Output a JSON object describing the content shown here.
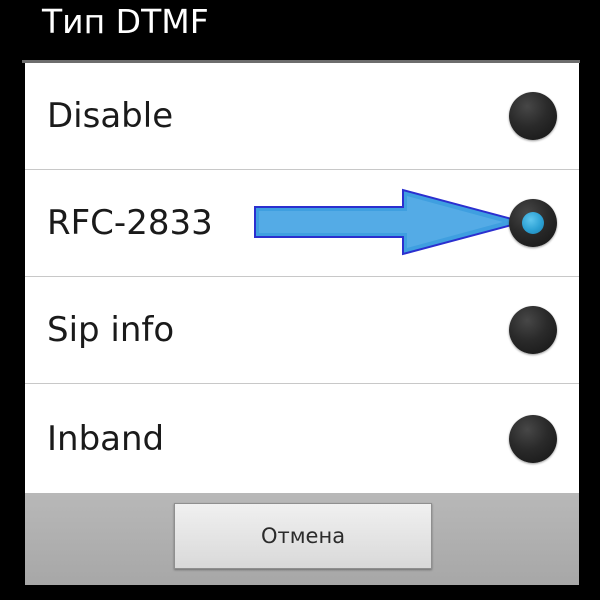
{
  "dialog": {
    "title": "Тип DTMF",
    "options": [
      {
        "label": "Disable",
        "checked": false
      },
      {
        "label": "RFC-2833",
        "checked": true
      },
      {
        "label": "Sip info",
        "checked": false
      },
      {
        "label": "Inband",
        "checked": false
      }
    ],
    "cancel_label": "Отмена"
  },
  "annotation": {
    "icon": "arrow-right-icon",
    "color": "#3f9fe0",
    "outline_color": "#2b2fcf",
    "points_to": "RFC-2833"
  },
  "colors": {
    "accent": "#2ca1d4",
    "title_bar": "#000000",
    "list_background": "#ffffff",
    "footer_background": "#adadad"
  }
}
